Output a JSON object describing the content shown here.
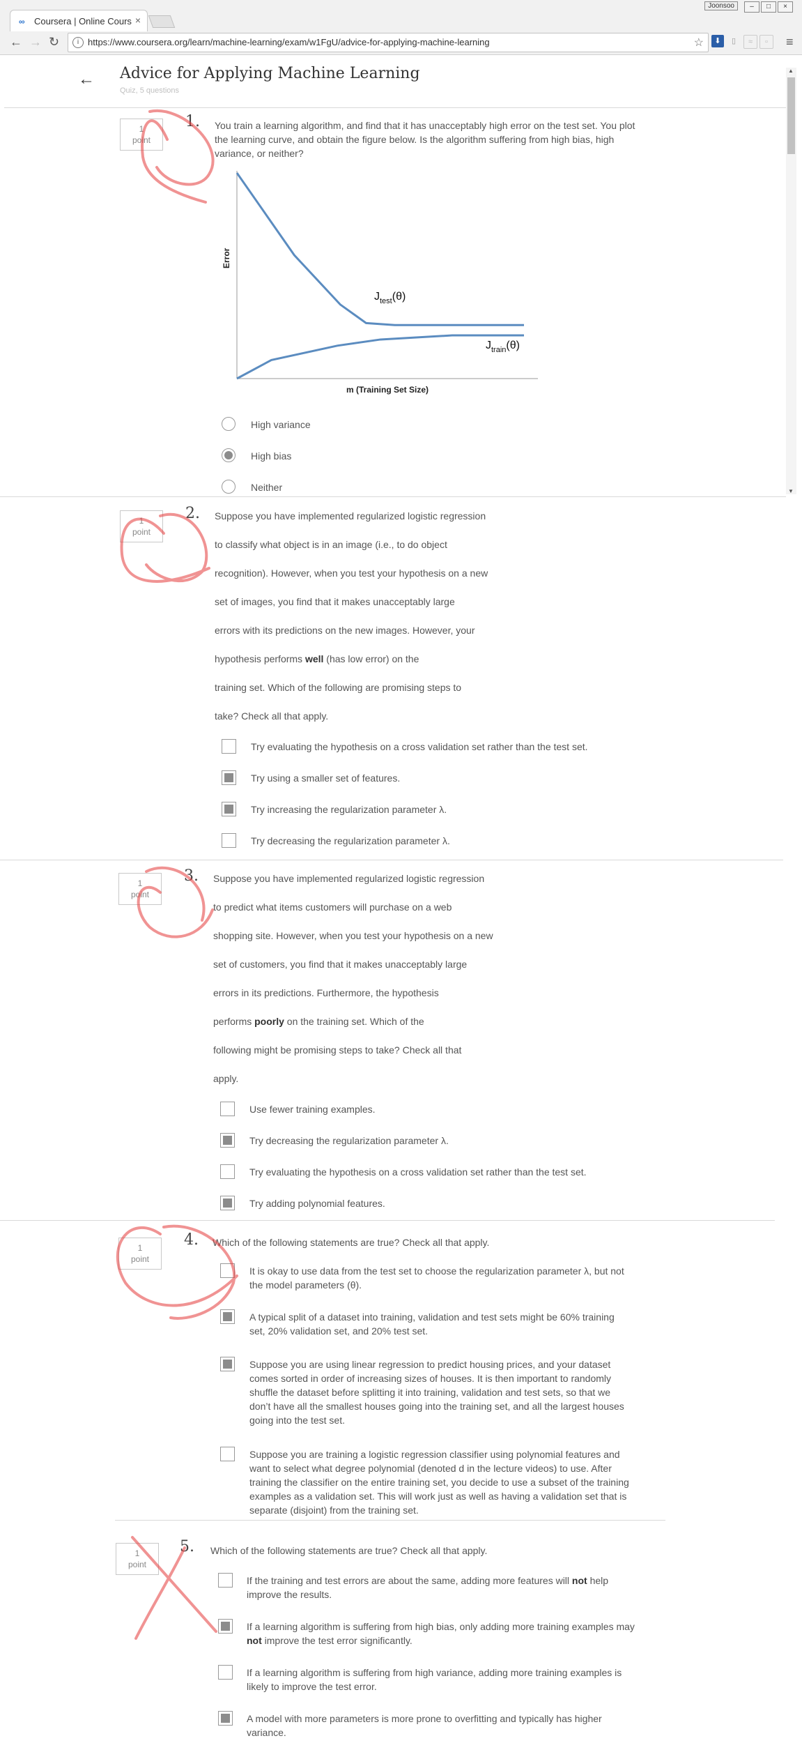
{
  "browser": {
    "tab_title": "Coursera | Online Course",
    "url": "https://www.coursera.org/learn/machine-learning/exam/w1FgU/advice-for-applying-machine-learning",
    "window_label": "Joonsoo"
  },
  "header": {
    "title": "Advice for Applying Machine Learning",
    "subtitle": "Quiz, 5 questions"
  },
  "point_label": {
    "value": "1",
    "unit": "point"
  },
  "q1": {
    "number": "1.",
    "text": "You train a learning algorithm, and find that it has unacceptably high error on the test set. You plot the learning curve, and obtain the figure below. Is the algorithm suffering from high bias, high variance, or neither?",
    "options": [
      {
        "label": "High variance",
        "selected": false
      },
      {
        "label": "High bias",
        "selected": true
      },
      {
        "label": "Neither",
        "selected": false
      }
    ]
  },
  "chart_data": {
    "type": "line",
    "xlabel": "m (Training Set Size)",
    "ylabel": "Error",
    "series": [
      {
        "name": "Jtest(θ)",
        "x": [
          0,
          0.08,
          0.2,
          0.36,
          0.45,
          0.55,
          0.7,
          1.0
        ],
        "values": [
          1.0,
          0.84,
          0.6,
          0.36,
          0.27,
          0.26,
          0.26,
          0.26
        ]
      },
      {
        "name": "Jtrain(θ)",
        "x": [
          0,
          0.12,
          0.35,
          0.5,
          0.75,
          1.0
        ],
        "values": [
          0.0,
          0.09,
          0.16,
          0.19,
          0.21,
          0.21
        ]
      }
    ],
    "curve_labels": {
      "test": {
        "main": "J",
        "sub": "test",
        "suffix": "(θ)"
      },
      "train": {
        "main": "J",
        "sub": "train",
        "suffix": "(θ)"
      }
    },
    "grid": false
  },
  "q2": {
    "number": "2.",
    "lines": [
      "Suppose you have implemented regularized logistic regression",
      "to classify what object is in an image (i.e., to do object",
      "recognition). However, when you test your hypothesis on a new",
      "set of images, you find that it makes unacceptably large",
      "errors with its predictions on the new images. However, your",
      "hypothesis performs |well| (has low error) on the",
      "training set. Which of the following are promising steps to",
      "take? Check all that apply."
    ],
    "options": [
      {
        "label": "Try evaluating the hypothesis on a cross validation set rather than the test set.",
        "selected": false
      },
      {
        "label": "Try using a smaller set of features.",
        "selected": true
      },
      {
        "label": "Try increasing the regularization parameter λ.",
        "selected": true
      },
      {
        "label": "Try decreasing the regularization parameter λ.",
        "selected": false
      }
    ]
  },
  "q3": {
    "number": "3.",
    "lines": [
      "Suppose you have implemented regularized logistic regression",
      "to predict what items customers will purchase on a web",
      "shopping site. However, when you test your hypothesis on a new",
      "set of customers, you find that it makes unacceptably large",
      "errors in its predictions. Furthermore, the hypothesis",
      "performs |poorly| on the training set. Which of the",
      "following might be promising steps to take? Check all that",
      "apply."
    ],
    "options": [
      {
        "label": "Use fewer training examples.",
        "selected": false
      },
      {
        "label": "Try decreasing the regularization parameter λ.",
        "selected": true
      },
      {
        "label": "Try evaluating the hypothesis on a cross validation set rather than the test set.",
        "selected": false
      },
      {
        "label": "Try adding polynomial features.",
        "selected": true
      }
    ]
  },
  "q4": {
    "number": "4.",
    "text": "Which of the following statements are true? Check all that apply.",
    "options": [
      {
        "label": "It is okay to use data from the test set to choose the regularization parameter λ, but not the model parameters (θ).",
        "selected": false
      },
      {
        "label": "A typical split of a dataset into training, validation and test sets might be 60% training set, 20% validation set, and 20% test set.",
        "selected": true
      },
      {
        "label": "Suppose you are using linear regression to predict housing prices, and your dataset comes sorted in order of increasing sizes of houses. It is then important to randomly shuffle the dataset before splitting it into training, validation and test sets, so that we don’t have all the smallest houses going into the training set, and all the largest houses going into the test set.",
        "selected": true
      },
      {
        "label": "Suppose you are training a logistic regression classifier using polynomial features and want to select what degree polynomial (denoted d in the lecture videos) to use. After training the classifier on the entire training set, you decide to use a subset of the training examples as a validation set. This will work just as well as having a validation set that is separate (disjoint) from the training set.",
        "selected": false
      }
    ]
  },
  "q5": {
    "number": "5.",
    "text": "Which of the following statements are true? Check all that apply.",
    "options": [
      {
        "label": "If the training and test errors are about the same, adding more features will |not| help improve the results.",
        "selected": false
      },
      {
        "label": "If a learning algorithm is suffering from high bias, only adding more training examples may |not| improve the test error significantly.",
        "selected": true
      },
      {
        "label": "If a learning algorithm is suffering from high variance, adding more training examples is likely to improve the test error.",
        "selected": false
      },
      {
        "label": "A model with more parameters is more prone to overfitting and typically has higher variance.",
        "selected": true
      }
    ]
  }
}
